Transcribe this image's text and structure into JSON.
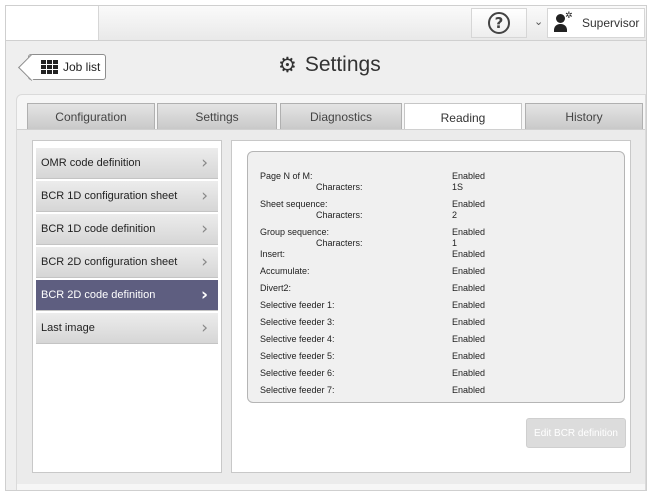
{
  "topbar": {
    "help_symbol": "?",
    "user_menu_chevron": "⌄",
    "user_label": "Supervisor",
    "user_icon": "user-gear-icon"
  },
  "header": {
    "back_label": "Job list",
    "back_icon": "grid-icon",
    "title": "Settings",
    "title_icon": "gear-icon"
  },
  "tabs": [
    {
      "label": "Configuration",
      "active": false
    },
    {
      "label": "Settings",
      "active": false
    },
    {
      "label": "Diagnostics",
      "active": false
    },
    {
      "label": "Reading",
      "active": true
    },
    {
      "label": "History",
      "active": false
    }
  ],
  "sidebar": {
    "items": [
      {
        "label": "OMR code definition",
        "active": false
      },
      {
        "label": "BCR 1D configuration sheet",
        "active": false
      },
      {
        "label": "BCR 1D code definition",
        "active": false
      },
      {
        "label": "BCR 2D configuration sheet",
        "active": false
      },
      {
        "label": "BCR 2D code definition",
        "active": true
      },
      {
        "label": "Last image",
        "active": false
      }
    ],
    "arrow": "›"
  },
  "details": [
    {
      "label": "Page N of M:",
      "value": "Enabled",
      "sub": false
    },
    {
      "label": "Characters:",
      "value": "1S",
      "sub": true
    },
    {
      "label": "Sheet sequence:",
      "value": "Enabled",
      "sub": false
    },
    {
      "label": "Characters:",
      "value": "2",
      "sub": true
    },
    {
      "label": "Group sequence:",
      "value": "Enabled",
      "sub": false
    },
    {
      "label": "Characters:",
      "value": "1",
      "sub": true
    },
    {
      "label": "Insert:",
      "value": "Enabled",
      "sub": false
    },
    {
      "label": "Accumulate:",
      "value": "Enabled",
      "sub": false
    },
    {
      "label": "Divert2:",
      "value": "Enabled",
      "sub": false
    },
    {
      "label": "Selective feeder 1:",
      "value": "Enabled",
      "sub": false
    },
    {
      "label": "Selective feeder 3:",
      "value": "Enabled",
      "sub": false
    },
    {
      "label": "Selective feeder 4:",
      "value": "Enabled",
      "sub": false
    },
    {
      "label": "Selective feeder 5:",
      "value": "Enabled",
      "sub": false
    },
    {
      "label": "Selective feeder 6:",
      "value": "Enabled",
      "sub": false
    },
    {
      "label": "Selective feeder 7:",
      "value": "Enabled",
      "sub": false
    }
  ],
  "edit_button": {
    "label": "Edit BCR definition",
    "enabled": false
  },
  "colors": {
    "accent_selected": "#5e5e80",
    "tab_bg": "#d6d6d6",
    "panel_bg": "#f0f0f0"
  }
}
